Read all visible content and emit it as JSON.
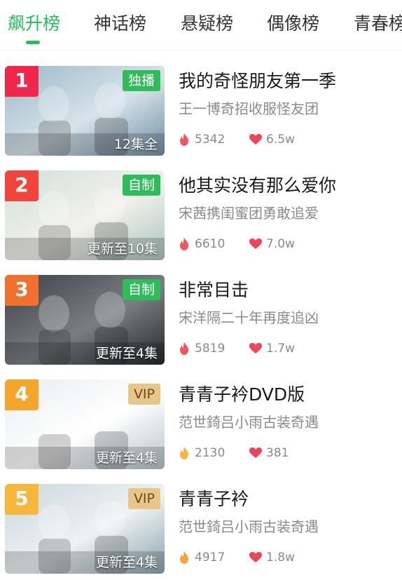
{
  "tabs": [
    "飙升榜",
    "神话榜",
    "悬疑榜",
    "偶像榜",
    "青春榜"
  ],
  "active_tab": 0,
  "items": [
    {
      "rank": "1",
      "rank_color": "#f0264b",
      "badge": "独播",
      "badge_type": "green",
      "progress": "12集全",
      "title": "我的奇怪朋友第一季",
      "subtitle": "王一博奇招收服怪友团",
      "hot": "5342",
      "likes": "6.5w",
      "flame_color": "#f2555b",
      "poster": [
        "#9bb8c8",
        "#d7e3ea",
        "#6f8fa3"
      ]
    },
    {
      "rank": "2",
      "rank_color": "#f4433a",
      "badge": "自制",
      "badge_type": "green",
      "progress": "更新至10集",
      "title": "他其实没有那么爱你",
      "subtitle": "宋茜携闺蜜团勇敢追爱",
      "hot": "6610",
      "likes": "7.0w",
      "flame_color": "#f2555b",
      "poster": [
        "#cfe0da",
        "#f3f1ec",
        "#a9c4bd"
      ]
    },
    {
      "rank": "3",
      "rank_color": "#f36f2d",
      "badge": "自制",
      "badge_type": "green",
      "progress": "更新至4集",
      "title": "非常目击",
      "subtitle": "宋洋隔二十年再度追凶",
      "hot": "5819",
      "likes": "1.7w",
      "flame_color": "#f2555b",
      "poster": [
        "#3d4045",
        "#7a7d82",
        "#25272b"
      ]
    },
    {
      "rank": "4",
      "rank_color": "#f6a52b",
      "badge": "VIP",
      "badge_type": "vip",
      "progress": "更新至4集",
      "title": "青青子衿DVD版",
      "subtitle": "范世錡吕小雨古装奇遇",
      "hot": "2130",
      "likes": "381",
      "flame_color": "#f6b63a",
      "poster": [
        "#e9ecef",
        "#ffffff",
        "#b7c3cc"
      ]
    },
    {
      "rank": "5",
      "rank_color": "#f6b73b",
      "badge": "VIP",
      "badge_type": "vip",
      "progress": "更新至4集",
      "title": "青青子衿",
      "subtitle": "范世錡吕小雨古装奇遇",
      "hot": "4917",
      "likes": "1.8w",
      "flame_color": "#f6a53a",
      "poster": [
        "#c9d7dc",
        "#eef2f3",
        "#8aa4ad"
      ]
    }
  ],
  "colors": {
    "accent": "#22c05a",
    "heart": "#f0445a"
  }
}
